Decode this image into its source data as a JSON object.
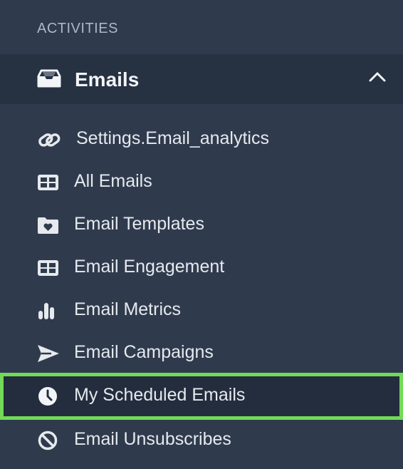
{
  "sidebar": {
    "section_label": "ACTIVITIES",
    "group": {
      "title": "Emails",
      "icon": "inbox-icon",
      "expanded": true
    },
    "items": [
      {
        "label": "Settings.Email_analytics",
        "icon": "link-icon"
      },
      {
        "label": "All Emails",
        "icon": "table-icon"
      },
      {
        "label": "Email Templates",
        "icon": "folder-heart-icon"
      },
      {
        "label": "Email Engagement",
        "icon": "table-icon"
      },
      {
        "label": "Email Metrics",
        "icon": "bar-chart-icon"
      },
      {
        "label": "Email Campaigns",
        "icon": "send-icon"
      },
      {
        "label": "My Scheduled Emails",
        "icon": "clock-icon",
        "active": true
      },
      {
        "label": "Email Unsubscribes",
        "icon": "block-icon"
      }
    ]
  },
  "colors": {
    "background": "#2f3b4d",
    "header_background": "#263142",
    "active_outline": "#72da56"
  }
}
